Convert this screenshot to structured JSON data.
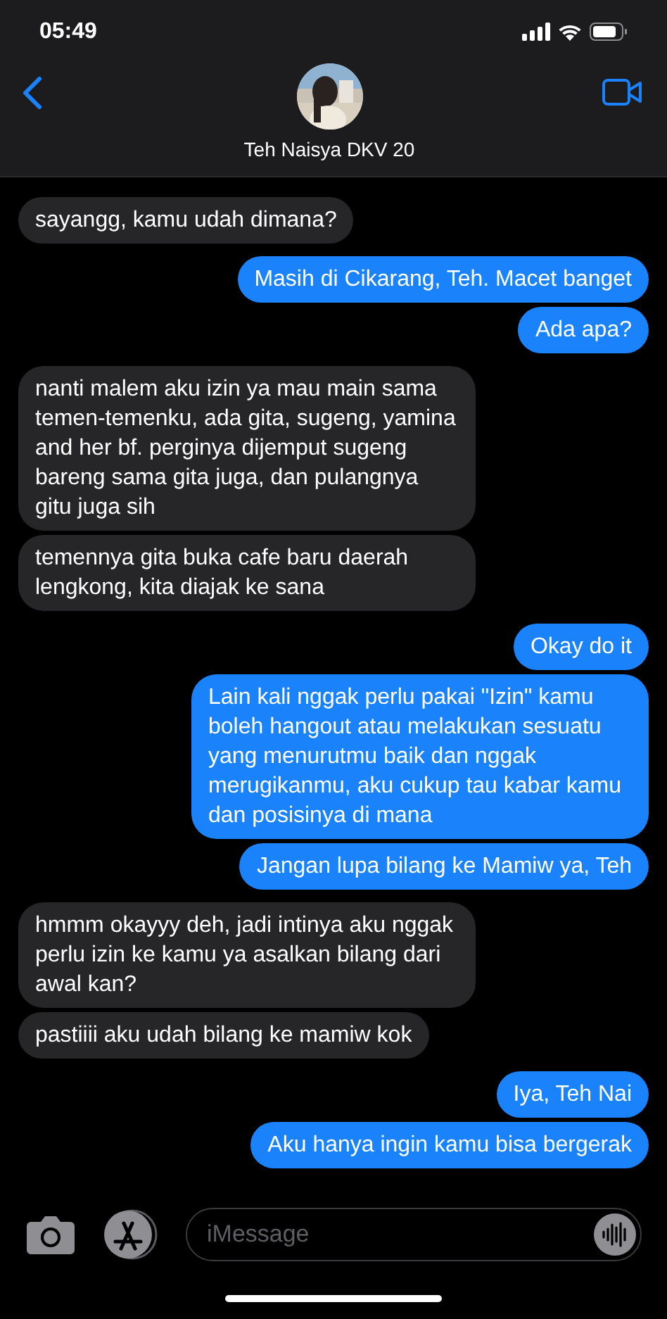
{
  "status_bar": {
    "time": "05:49"
  },
  "header": {
    "contact_name": "Teh Naisya DKV 20"
  },
  "messages": [
    {
      "kind": "incoming",
      "text": "sayangg, kamu udah dimana?"
    },
    {
      "kind": "outgoing",
      "text": "Masih di Cikarang, Teh. Macet banget"
    },
    {
      "kind": "outgoing",
      "text": "Ada apa?"
    },
    {
      "kind": "incoming",
      "text": "nanti malem aku izin ya mau main sama temen-temenku, ada gita, sugeng, yamina and her bf. perginya dijemput sugeng bareng sama gita juga, dan pulangnya gitu juga sih"
    },
    {
      "kind": "incoming",
      "text": "temennya gita buka cafe baru daerah lengkong, kita diajak ke sana"
    },
    {
      "kind": "outgoing",
      "text": "Okay do it"
    },
    {
      "kind": "outgoing",
      "text": "Lain kali nggak perlu pakai \"Izin\" kamu boleh hangout atau melakukan sesuatu yang menurutmu baik dan nggak merugikanmu, aku cukup tau kabar kamu dan posisinya di mana"
    },
    {
      "kind": "outgoing",
      "text": "Jangan lupa bilang ke Mamiw ya, Teh"
    },
    {
      "kind": "incoming",
      "text": "hmmm okayyy deh, jadi intinya aku nggak perlu izin ke kamu ya asalkan bilang dari awal kan?"
    },
    {
      "kind": "incoming",
      "text": "pastiiii aku udah bilang ke mamiw kok"
    },
    {
      "kind": "outgoing",
      "text": "Iya, Teh Nai"
    },
    {
      "kind": "outgoing",
      "text": "Aku hanya ingin kamu bisa bergerak"
    }
  ],
  "composer": {
    "placeholder": "iMessage"
  }
}
